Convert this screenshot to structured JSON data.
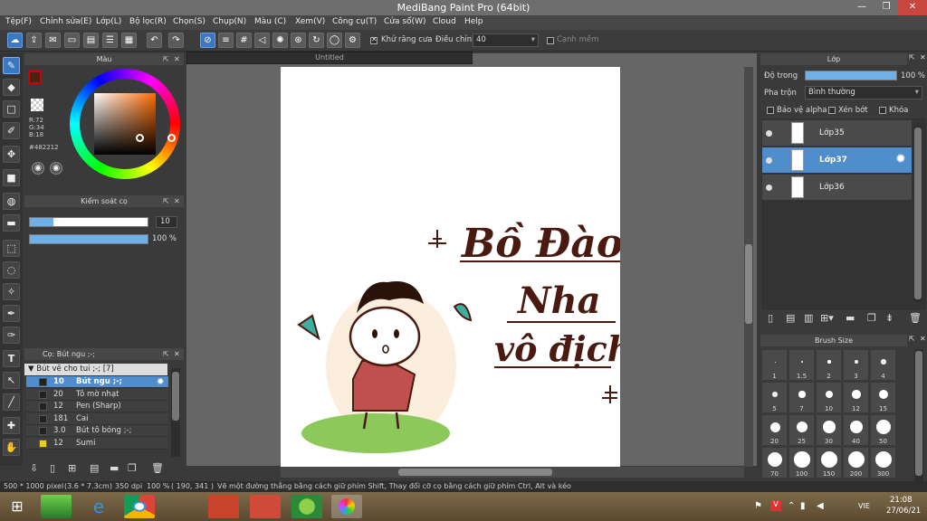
{
  "window": {
    "title": "MediBang Paint Pro (64bit)"
  },
  "menu": [
    "Tệp(F)",
    "Chỉnh sửa(E)",
    "Lớp(L)",
    "Bộ lọc(R)",
    "Chọn(S)",
    "Chụp(N)",
    "Màu (C)",
    "Xem(V)",
    "Công cụ(T)",
    "Cửa sổ(W)",
    "Cloud",
    "Help"
  ],
  "toolbar": {
    "antialias_label": "Khử răng cưa",
    "adjust_label": "Điều chỉnh",
    "adjust_value": "40",
    "edge_label": "Cạnh mềm"
  },
  "color_panel": {
    "title": "Màu",
    "r": "R:72",
    "g": "G:34",
    "b": "B:18",
    "hex": "#482212",
    "primary_color": "#482212"
  },
  "brush_control": {
    "title": "Kiểm soát cọ",
    "size_value": "10",
    "opacity_value": "100 %",
    "size_fraction": 0.2,
    "opacity_fraction": 1.0
  },
  "brush_panel": {
    "title": "Cọ: Bút ngu ;-;",
    "group": "Bút vẽ cho tui ;-; [7]",
    "items": [
      {
        "size": "10",
        "name": "Bút ngu ;-;",
        "color": "#222222"
      },
      {
        "size": "20",
        "name": "Tô mờ nhạt",
        "color": "#222222"
      },
      {
        "size": "12",
        "name": "Pen (Sharp)",
        "color": "#222222"
      },
      {
        "size": "181",
        "name": "Cai",
        "color": "#222222"
      },
      {
        "size": "3.0",
        "name": "Bút tô bóng ;-;",
        "color": "#222222"
      },
      {
        "size": "12",
        "name": "Sumi",
        "color": "#e8d020"
      }
    ]
  },
  "document": {
    "tab": "Untitled",
    "art": {
      "line1": "Bồ Đào",
      "line2": "Nha",
      "line3": "vô địch",
      "ink": "#4a1a10"
    }
  },
  "layer_panel": {
    "title": "Lớp",
    "opacity_label": "Độ trong",
    "opacity_value": "100 %",
    "opacity_fraction": 1.0,
    "blend_label": "Pha trộn",
    "blend_value": "Bình thường",
    "protect_alpha": "Bảo vệ alpha",
    "clipping": "Xén bớt",
    "lock": "Khóa",
    "layers": [
      {
        "name": "Lớp35"
      },
      {
        "name": "Lớp37"
      },
      {
        "name": "Lớp36"
      }
    ]
  },
  "brush_size_panel": {
    "title": "Brush Size",
    "sizes": [
      "1",
      "1.5",
      "2",
      "3",
      "4",
      "5",
      "7",
      "10",
      "12",
      "15",
      "20",
      "25",
      "30",
      "40",
      "50",
      "70",
      "100",
      "150",
      "200",
      "300"
    ]
  },
  "status": {
    "size": "500 * 1000 pixel",
    "cm": "(3.6 * 7.3cm)",
    "dpi": "350 dpi",
    "zoom": "100 %",
    "coords": "( 190, 341 )",
    "hint": "Vẽ một đường thẳng bằng cách giữ phím Shift, Thay đổi cỡ cọ bằng cách giữ phím Ctrl, Alt và kéo"
  },
  "taskbar": {
    "lang": "VIE",
    "time": "21:08",
    "date": "27/06/21"
  },
  "accent": "#4f8dcc"
}
